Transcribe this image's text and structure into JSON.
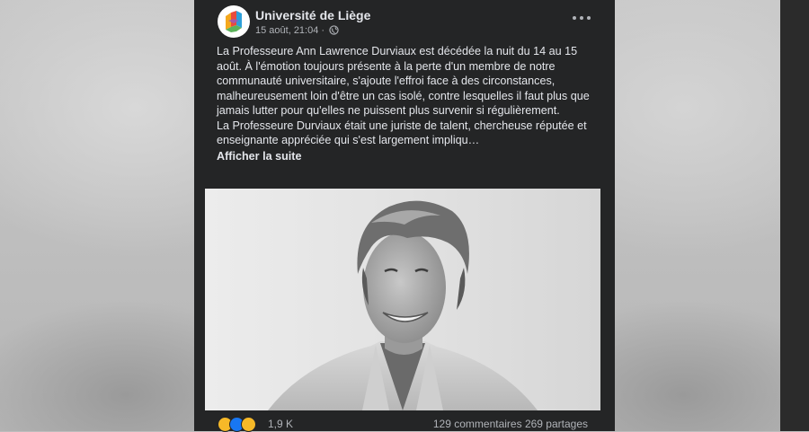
{
  "post": {
    "page_name": "Université de Liège",
    "timestamp": "15 août, 21:04",
    "separator": "·",
    "privacy_icon": "globe-icon",
    "menu_icon": "more-options-icon",
    "paragraph1": "La Professeure Ann Lawrence Durviaux est décédée la nuit du 14 au 15 août. À l'émotion toujours présente à la perte d'un membre de notre communauté universitaire, s'ajoute l'effroi face à des circonstances, malheureusement loin d'être un cas isolé, contre lesquelles il faut plus que jamais lutter pour qu'elles ne puissent plus survenir si régulièrement.",
    "paragraph2": "La Professeure Durviaux était une juriste de talent, chercheuse réputée et enseignante appréciée qui s'est largement impliqu…",
    "see_more": "Afficher la suite",
    "photo_description": "black-and-white portrait photo",
    "reactions": {
      "icons": [
        "sad-reaction-icon",
        "like-reaction-icon",
        "care-reaction-icon"
      ],
      "count": "1,9 K"
    },
    "comments": "129 commentaires",
    "shares": "269 partages"
  },
  "colors": {
    "card_bg": "#242526",
    "text_primary": "#e4e6eb",
    "text_secondary": "#b0b3b8",
    "like_blue": "#1877f2",
    "reaction_yellow": "#f7b928"
  }
}
